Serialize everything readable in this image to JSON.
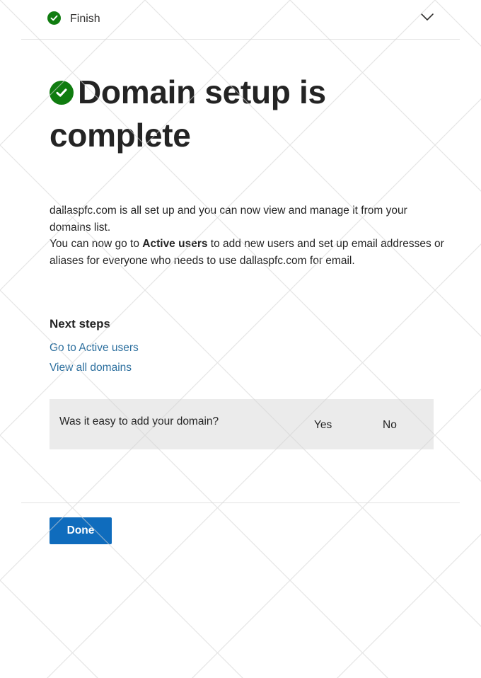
{
  "header": {
    "step_label": "Finish",
    "step_icon": "check-circle-icon",
    "collapse_icon": "chevron-down-icon"
  },
  "main": {
    "title": "Domain setup is complete",
    "title_icon": "check-circle-icon",
    "paragraph1": "dallaspfc.com is all set up and you can now view and manage it from your domains list.",
    "paragraph2_prefix": "You can now go to ",
    "paragraph2_bold": "Active users",
    "paragraph2_suffix": " to add new users and set up email addresses or aliases for everyone who needs to use dallaspfc.com for email."
  },
  "next_steps": {
    "heading": "Next steps",
    "links": [
      {
        "label": "Go to Active users"
      },
      {
        "label": "View all domains"
      }
    ]
  },
  "feedback": {
    "question": "Was it easy to add your domain?",
    "yes_label": "Yes",
    "no_label": "No"
  },
  "footer": {
    "done_label": "Done"
  },
  "colors": {
    "success": "#107c10",
    "link": "#2c6f9e",
    "primary_button": "#0f6cbd",
    "feedback_bg": "#ebebeb"
  }
}
